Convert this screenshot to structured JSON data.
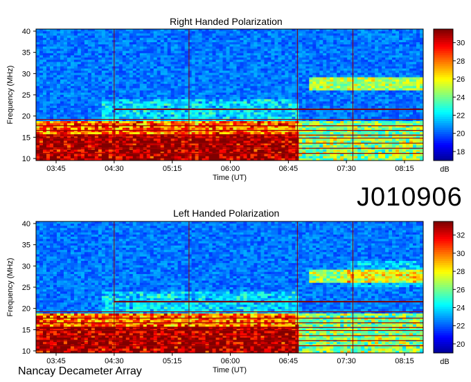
{
  "top_title": "Right Handed Polarization",
  "bottom_title": "Left Handed Polarization",
  "observation_id": "J010906",
  "instrument": "Nancay Decameter Array",
  "colors": {
    "colormap": [
      "#00008f",
      "#0000ff",
      "#0080ff",
      "#00ffff",
      "#80ff80",
      "#ffff00",
      "#ff8000",
      "#ff0000",
      "#800000"
    ]
  },
  "chart_data": [
    {
      "type": "heatmap",
      "title": "Right Handed Polarization",
      "xlabel": "Time (UT)",
      "ylabel": "Frequency (MHz)",
      "xticks": [
        "03:45",
        "04:30",
        "05:15",
        "06:00",
        "06:45",
        "07:30",
        "08:15"
      ],
      "yticks": [
        "10",
        "15",
        "20",
        "25",
        "30",
        "35",
        "40"
      ],
      "ylim": [
        10,
        40
      ],
      "colorbar": {
        "label": "dB",
        "ticks": [
          "18",
          "20",
          "22",
          "24",
          "26",
          "28",
          "30"
        ],
        "range": [
          17,
          31.5
        ]
      },
      "vertical_markers": [
        "04:30",
        "05:28",
        "06:52",
        "07:35"
      ]
    },
    {
      "type": "heatmap",
      "title": "Left Handed Polarization",
      "xlabel": "Time (UT)",
      "ylabel": "Frequency (MHz)",
      "xticks": [
        "03:45",
        "04:30",
        "05:15",
        "06:00",
        "06:45",
        "07:30",
        "08:15"
      ],
      "yticks": [
        "10",
        "15",
        "20",
        "25",
        "30",
        "35",
        "40"
      ],
      "ylim": [
        10,
        40
      ],
      "colorbar": {
        "label": "dB",
        "ticks": [
          "20",
          "22",
          "24",
          "26",
          "28",
          "30",
          "32"
        ],
        "range": [
          19,
          33.5
        ]
      },
      "vertical_markers": [
        "04:30",
        "05:28",
        "06:52",
        "07:35"
      ]
    }
  ]
}
